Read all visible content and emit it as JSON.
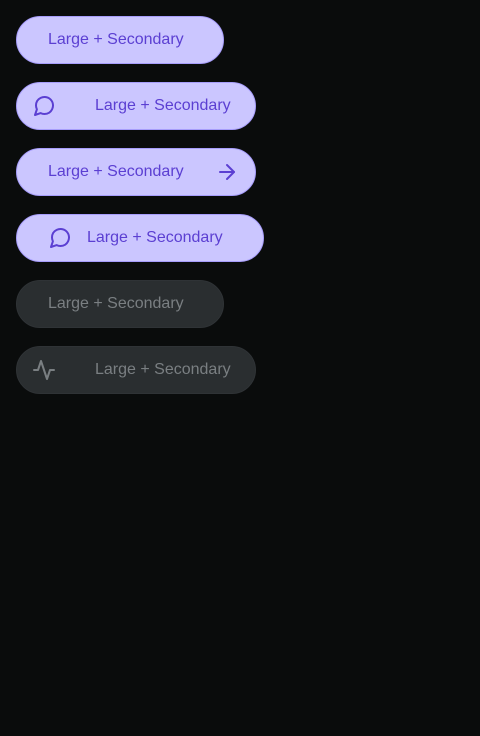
{
  "colors": {
    "page_background": "#0a0c0c",
    "primary_fill": "#cbc6ff",
    "primary_border": "#a79dfb",
    "primary_text": "#5b3fd2",
    "disabled_fill": "#2a2e30",
    "disabled_text": "#7a7f82"
  },
  "buttons": [
    {
      "label": "Large + Secondary",
      "icon": null,
      "state": "enabled"
    },
    {
      "label": "Large + Secondary",
      "icon": "chat-bubble-icon",
      "icon_position": "leading",
      "state": "enabled"
    },
    {
      "label": "Large + Secondary",
      "icon": "arrow-right-icon",
      "icon_position": "trailing",
      "state": "enabled"
    },
    {
      "label": "Large + Secondary",
      "icon": "chat-bubble-icon",
      "icon_position": "leading",
      "state": "enabled"
    },
    {
      "label": "Large + Secondary",
      "icon": null,
      "state": "disabled"
    },
    {
      "label": "Large + Secondary",
      "icon": "activity-pulse-icon",
      "icon_position": "leading",
      "state": "disabled"
    }
  ]
}
